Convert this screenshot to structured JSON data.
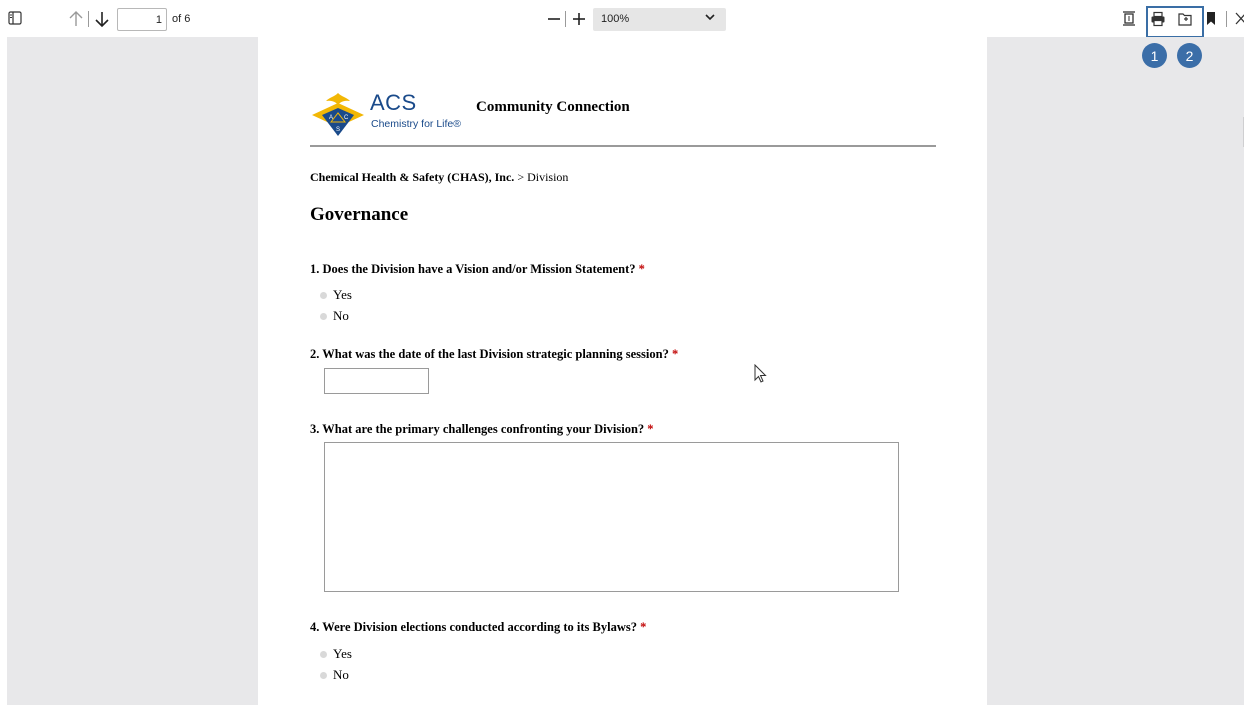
{
  "toolbar": {
    "page_current": "1",
    "page_total_label": "of 6",
    "zoom_value": "100%"
  },
  "annotations": {
    "badge_1": "1",
    "badge_2": "2"
  },
  "document": {
    "logo": {
      "brand": "ACS",
      "tagline": "Chemistry for Life®",
      "seal_letters": "A C S"
    },
    "site_title": "Community Connection",
    "breadcrumb": {
      "org": "Chemical Health & Safety (CHAS), Inc.",
      "separator": " > ",
      "section": "Division"
    },
    "page_title": "Governance",
    "required_mark": "*",
    "questions": [
      {
        "text": "1. Does the Division have a Vision and/or Mission Statement?",
        "type": "radio",
        "options": [
          "Yes",
          "No"
        ]
      },
      {
        "text": "2. What was the date of the last Division strategic planning session?",
        "type": "text",
        "value": ""
      },
      {
        "text": "3. What are the primary challenges confronting your Division?",
        "type": "textarea",
        "value": ""
      },
      {
        "text": "4. Were Division elections conducted according to its Bylaws?",
        "type": "radio",
        "options": [
          "Yes",
          "No"
        ]
      }
    ]
  },
  "colors": {
    "accent_blue": "#3b6ea8",
    "required_red": "#c00000",
    "acs_blue": "#1a4a8a",
    "acs_gold": "#f2b705"
  }
}
